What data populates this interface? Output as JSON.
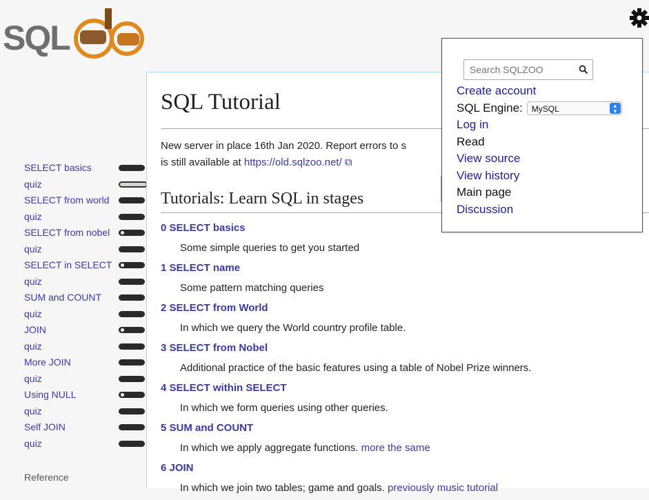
{
  "logo": {
    "text": "SQLZOO"
  },
  "sidebar": {
    "items": [
      {
        "label": "SELECT basics",
        "bar": "dark"
      },
      {
        "label": "quiz",
        "bar": "light"
      },
      {
        "label": "SELECT from world",
        "bar": "dark"
      },
      {
        "label": "quiz",
        "bar": "dark"
      },
      {
        "label": "SELECT from nobel",
        "bar": "dot"
      },
      {
        "label": "quiz",
        "bar": "dark"
      },
      {
        "label": "SELECT in SELECT",
        "bar": "dot"
      },
      {
        "label": "quiz",
        "bar": "dark"
      },
      {
        "label": "SUM and COUNT",
        "bar": "dark"
      },
      {
        "label": "quiz",
        "bar": "dark"
      },
      {
        "label": "JOIN",
        "bar": "dot"
      },
      {
        "label": "quiz",
        "bar": "dark"
      },
      {
        "label": "More JOIN",
        "bar": "dark"
      },
      {
        "label": "quiz",
        "bar": "dark"
      },
      {
        "label": "Using NULL",
        "bar": "dot"
      },
      {
        "label": "quiz",
        "bar": "dark"
      },
      {
        "label": "Self JOIN",
        "bar": "dark"
      },
      {
        "label": "quiz",
        "bar": "dark"
      }
    ],
    "reference": "Reference"
  },
  "main": {
    "title": "SQL Tutorial",
    "notice_line1": "New server in place 16th Jan 2020. Report errors to s",
    "notice_line2_prefix": "is still available at ",
    "notice_link": "https://old.sqlzoo.net/",
    "section_title": "Tutorials: Learn SQL in stages",
    "tutorials": [
      {
        "title": "0 SELECT basics",
        "desc": "Some simple queries to get you started",
        "extra": ""
      },
      {
        "title": "1 SELECT name",
        "desc": "Some pattern matching queries",
        "extra": ""
      },
      {
        "title": "2 SELECT from World",
        "desc": "In which we query the World country profile table.",
        "extra": ""
      },
      {
        "title": "3 SELECT from Nobel",
        "desc": "Additional practice of the basic features using a table of Nobel Prize winners.",
        "extra": ""
      },
      {
        "title": "4 SELECT within SELECT",
        "desc": "In which we form queries using other queries.",
        "extra": ""
      },
      {
        "title": "5 SUM and COUNT",
        "desc": "In which we apply aggregate functions. ",
        "extra": "more the same"
      },
      {
        "title": "6 JOIN",
        "desc": "In which we join two tables; game and goals. ",
        "extra": "previously music tutorial"
      }
    ]
  },
  "popup": {
    "search_placeholder": "Search SQLZOO",
    "create_account": "Create account",
    "engine_label": "SQL Engine:",
    "engine_value": "MySQL",
    "log_in": "Log in",
    "read": "Read",
    "view_source": "View source",
    "view_history": "View history",
    "main_page": "Main page",
    "discussion": "Discussion"
  }
}
